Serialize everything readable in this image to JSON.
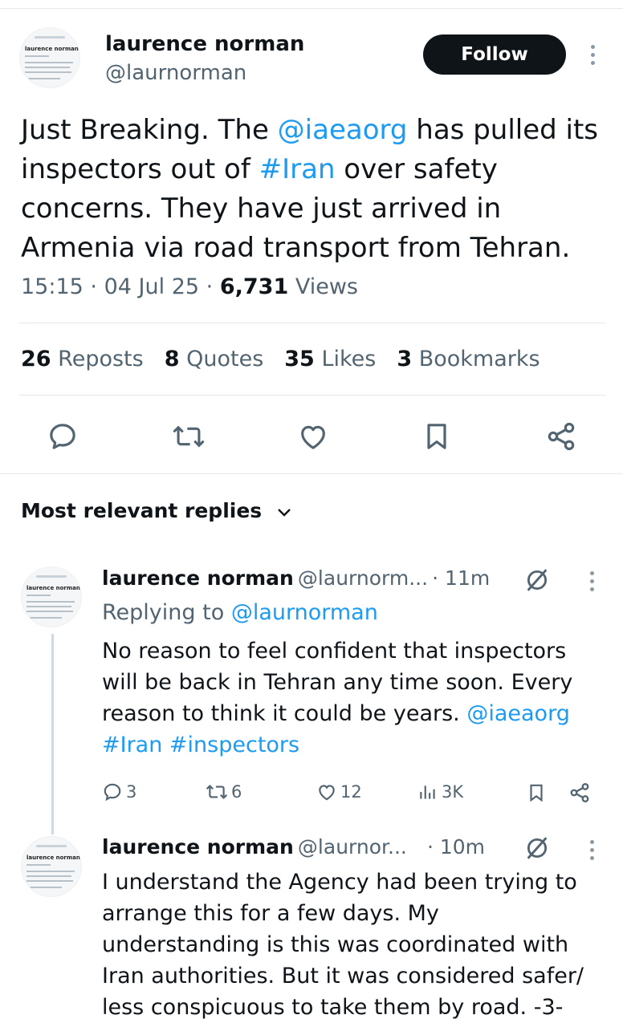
{
  "tweet": {
    "author_name": "laurence norman",
    "author_handle": "@laurnorman",
    "follow_label": "Follow",
    "text": {
      "t1": "Just Breaking. The ",
      "mention": "@iaeaorg",
      "t2": " has pulled its inspectors out of ",
      "hashtag": "#Iran",
      "t3": " over safety concerns. They have just arrived in Armenia via road transport from Tehran."
    },
    "time": "15:15",
    "date": "04 Jul 25",
    "views_count": "6,731",
    "views_label": "Views",
    "separator": "·",
    "stats": [
      {
        "count": "26",
        "label": "Reposts"
      },
      {
        "count": "8",
        "label": "Quotes"
      },
      {
        "count": "35",
        "label": "Likes"
      },
      {
        "count": "3",
        "label": "Bookmarks"
      }
    ],
    "avatar_text": {
      "name": "laurence norman"
    }
  },
  "actions": [
    "reply-icon",
    "repost-icon",
    "like-icon",
    "bookmark-icon",
    "share-icon"
  ],
  "replies_header": {
    "label": "Most relevant replies"
  },
  "replies": [
    {
      "name": "laurence norman",
      "handle": "@laurnorm...",
      "time": "· 11m",
      "replying_prefix": "Replying to ",
      "replying_to": "@laurnorman",
      "text1": "No reason to feel confident that inspectors will be back in Tehran any time soon. Every reason to think it could be years. ",
      "mention": "@iaeaorg",
      "hashtags": "#Iran #inspectors",
      "stats": {
        "replies": "3",
        "reposts": "6",
        "likes": "12",
        "views": "3K"
      }
    },
    {
      "name": "laurence norman",
      "handle": "@laurnor...",
      "time": "· 10m",
      "text": "I understand the Agency had been trying to arrange this for a few days. My understanding is this was coordinated with Iran authorities. But it was considered safer/ less conspicuous to take them by road. -3-"
    }
  ],
  "colors": {
    "link": "#1d9bf0",
    "muted": "#536471",
    "text": "#0f1419",
    "divider": "#e6e9ec"
  }
}
